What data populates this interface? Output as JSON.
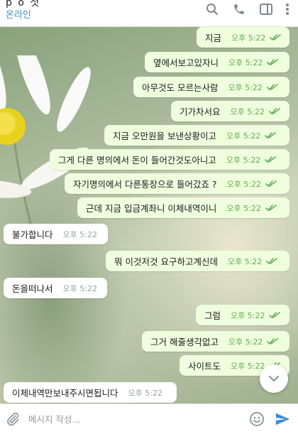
{
  "header": {
    "name": "p o 첫",
    "status": "온라인",
    "icons": [
      "search-icon",
      "phone-icon",
      "sidebar-toggle-icon",
      "more-vertical-icon"
    ]
  },
  "colors": {
    "accent": "#3a8fd0",
    "outgoing_bubble": "#efffde",
    "incoming_bubble": "#ffffff",
    "read_ticks": "#5fae4e",
    "send": "#3a8fd0"
  },
  "messages": [
    {
      "dir": "out",
      "text": "지금",
      "time": "오후 5:22",
      "read": true
    },
    {
      "dir": "out",
      "text": "옆에서보고있자니",
      "time": "오후 5:22",
      "read": true
    },
    {
      "dir": "out",
      "text": "아무것도 모르는사람",
      "time": "오후 5:22",
      "read": true
    },
    {
      "dir": "out",
      "text": "기가차서요",
      "time": "오후 5:22",
      "read": true
    },
    {
      "dir": "out",
      "text": "지금 오만원을 보낸상황이고",
      "time": "오후 5:22",
      "read": true
    },
    {
      "dir": "out",
      "text": "그게 다른 명의에서 돈이 들어간것도아니고",
      "time": "오후 5:22",
      "read": true
    },
    {
      "dir": "out",
      "text": "자기명의에서 다른통장으로 들어갔죠 ?",
      "time": "오후 5:22",
      "read": true
    },
    {
      "dir": "out",
      "text": "근데 지금 입금계좌니 이체내역이니",
      "time": "오후 5:22",
      "read": true
    },
    {
      "dir": "in",
      "text": "불가합니다",
      "time": "오후 5:22"
    },
    {
      "dir": "out",
      "text": "뭐 이것저것 요구하고계신데",
      "time": "오후 5:22",
      "read": true
    },
    {
      "dir": "in",
      "text": "돈을떠나서",
      "time": "오후 5:22"
    },
    {
      "dir": "out",
      "text": "그럼",
      "time": "오후 5:22",
      "read": true
    },
    {
      "dir": "out",
      "text": "그거 해줄생각없고",
      "time": "오후 5:22",
      "read": true
    },
    {
      "dir": "out",
      "text": "사이트도",
      "time": "오후 5:22",
      "read": true
    },
    {
      "dir": "in",
      "text": "이체내역만보내주시면됩니다",
      "time": "오후 5:22"
    }
  ],
  "input": {
    "placeholder": "메시지 작성..."
  }
}
